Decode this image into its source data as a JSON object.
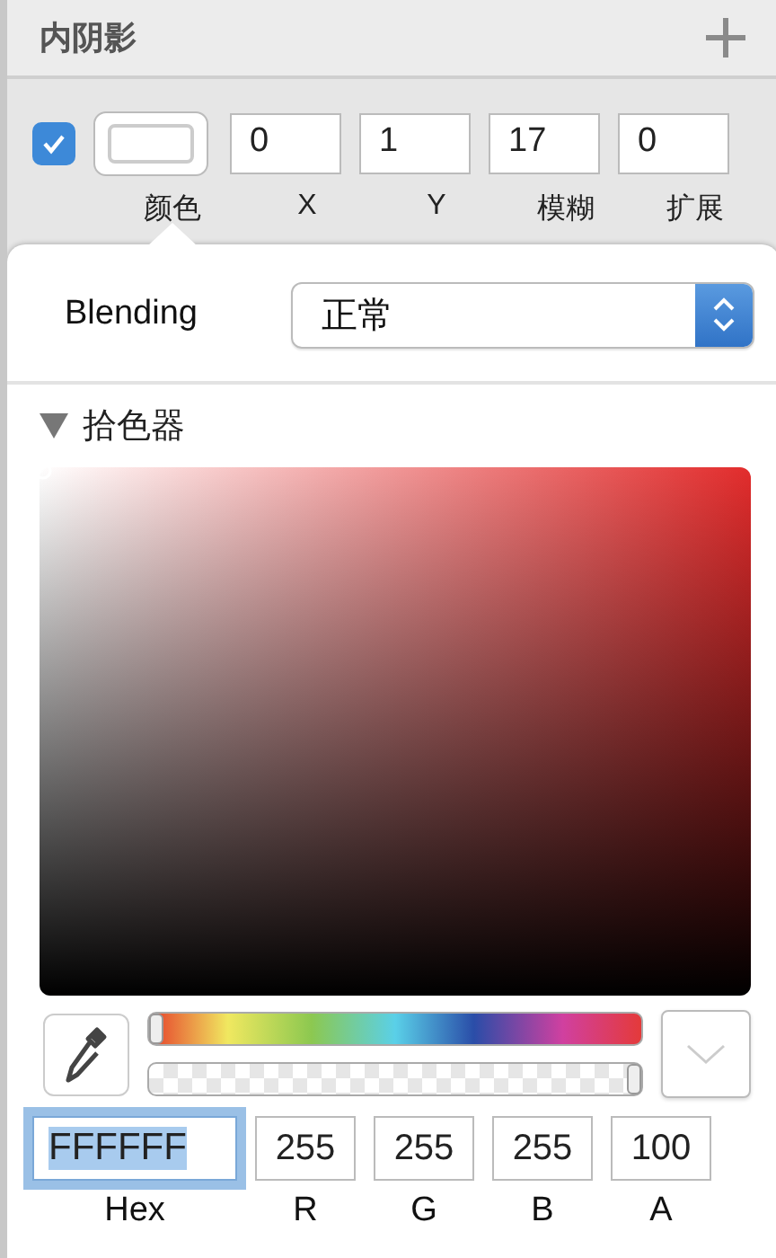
{
  "section": {
    "title": "内阴影"
  },
  "shadow": {
    "enabled": true,
    "color": "#ffffff",
    "color_label": "颜色",
    "fields": [
      {
        "value": "0",
        "label": "X"
      },
      {
        "value": "1",
        "label": "Y"
      },
      {
        "value": "17",
        "label": "模糊"
      },
      {
        "value": "0",
        "label": "扩展"
      }
    ]
  },
  "blending": {
    "label": "Blending",
    "value": "正常"
  },
  "picker": {
    "title": "拾色器",
    "expanded": true,
    "hue": {
      "level": 0
    },
    "alpha": {
      "level": 1
    },
    "fields": [
      {
        "value": "FFFFFF",
        "label": "Hex",
        "focused": true
      },
      {
        "value": "255",
        "label": "R",
        "focused": false
      },
      {
        "value": "255",
        "label": "G",
        "focused": false
      },
      {
        "value": "255",
        "label": "B",
        "focused": false
      },
      {
        "value": "100",
        "label": "A",
        "focused": false
      }
    ]
  }
}
